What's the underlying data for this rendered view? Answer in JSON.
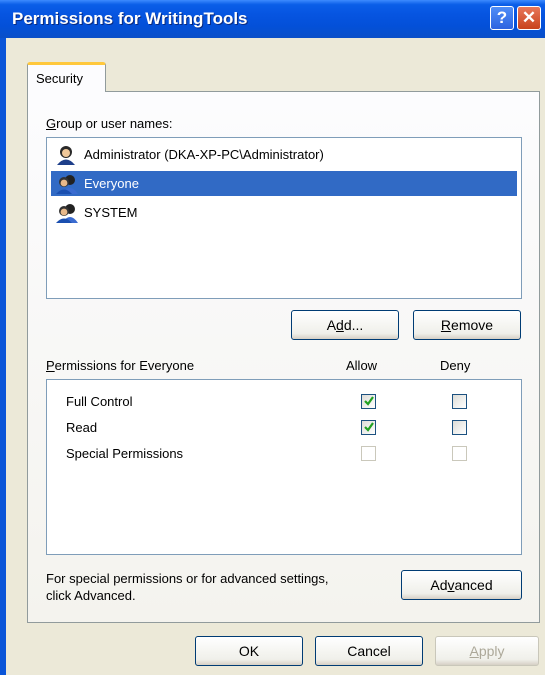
{
  "window": {
    "title": "Permissions for WritingTools",
    "help_glyph": "?",
    "close_glyph": "✕"
  },
  "tabs": [
    {
      "label": "Security",
      "active": true
    }
  ],
  "group_section": {
    "label_prefix": "",
    "label_accel": "G",
    "label_rest": "roup or user names:",
    "users": [
      {
        "name": "Administrator (DKA-XP-PC\\Administrator)",
        "icon": "user-icon",
        "selected": false
      },
      {
        "name": "Everyone",
        "icon": "users-group-icon",
        "selected": true
      },
      {
        "name": "SYSTEM",
        "icon": "users-group-icon",
        "selected": false
      }
    ]
  },
  "buttons": {
    "add_accel": "d",
    "add_prefix": "A",
    "add_rest": "d...",
    "remove_accel": "R",
    "remove_rest": "emove",
    "advanced_prefix": "Ad",
    "advanced_accel": "v",
    "advanced_rest": "anced",
    "ok": "OK",
    "cancel": "Cancel",
    "apply_accel": "A",
    "apply_rest": "pply"
  },
  "permissions": {
    "label_accel": "P",
    "label_rest": "ermissions for Everyone",
    "allow_header": "Allow",
    "deny_header": "Deny",
    "rows": [
      {
        "name": "Full Control",
        "allow": true,
        "deny": false,
        "disabled": false
      },
      {
        "name": "Read",
        "allow": true,
        "deny": false,
        "disabled": false
      },
      {
        "name": "Special Permissions",
        "allow": false,
        "deny": false,
        "disabled": true
      }
    ]
  },
  "footer_note": {
    "line1": "For special permissions or for advanced settings,",
    "line2": "click Advanced."
  },
  "colors": {
    "titlebar": "#0a5ee8",
    "selection": "#316ac5",
    "check": "#21a121",
    "tab_highlight": "#ffc83c"
  }
}
